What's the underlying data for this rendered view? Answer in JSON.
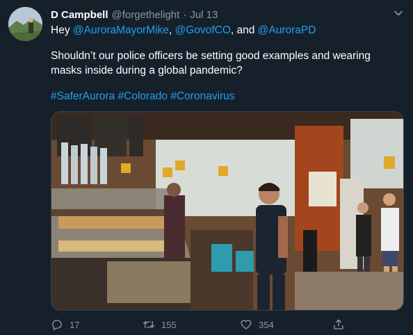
{
  "tweet": {
    "display_name": "D Campbell",
    "handle": "@forgethelight",
    "separator": "·",
    "time": "Jul 13",
    "line1": {
      "prefix": "Hey ",
      "mention1": "@AuroraMayorMike",
      "sep1": ", ",
      "mention2": "@GovofCO",
      "sep2": ", and ",
      "mention3": "@AuroraPD"
    },
    "line2": "Shouldn’t our police officers be setting good examples and wearing masks inside during a global pandemic?",
    "hashtags": {
      "tag1": "#SaferAurora",
      "tag2": "#Colorado",
      "tag3": "#Coronavirus"
    }
  },
  "actions": {
    "reply_count": "17",
    "retweet_count": "155",
    "like_count": "354"
  },
  "icons": {
    "caret": "chevron-down-icon",
    "reply": "reply-icon",
    "retweet": "retweet-icon",
    "like": "heart-icon",
    "share": "share-icon"
  },
  "colors": {
    "background": "#15202b",
    "link": "#1da1f2",
    "muted": "#8899a6"
  }
}
